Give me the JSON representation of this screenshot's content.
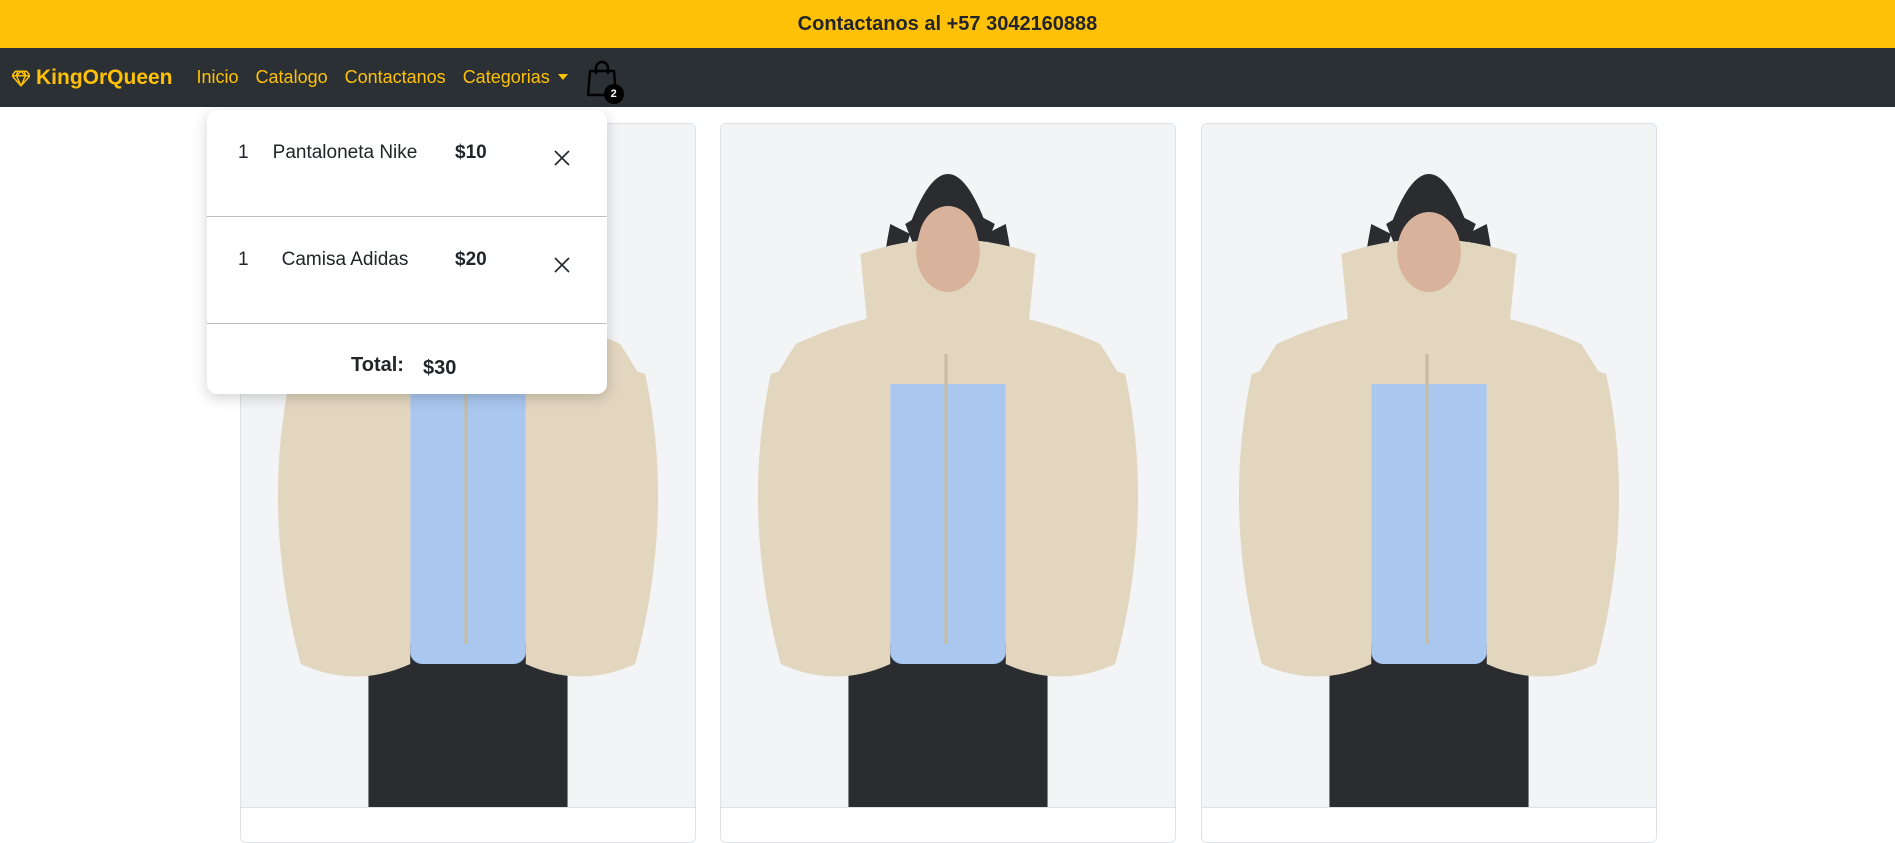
{
  "topbar": {
    "contact_text": "Contactanos al +57 3042160888"
  },
  "navbar": {
    "brand": "KingOrQueen",
    "links": [
      "Inicio",
      "Catalogo",
      "Contactanos",
      "Categorias"
    ],
    "cart_count": "2"
  },
  "cart": {
    "items": [
      {
        "qty": "1",
        "name": "Pantaloneta Nike",
        "price": "$10"
      },
      {
        "qty": "1",
        "name": "Camisa Adidas",
        "price": "$20"
      }
    ],
    "total_label": "Total:",
    "total_value": "$30"
  },
  "colors": {
    "accent": "#ffc107",
    "navbar_bg": "#2b3035",
    "jacket": "#e2d6bf",
    "shirt": "#a9c7ef",
    "pants": "#2a2c30"
  },
  "icons": {
    "brand": "gem-icon",
    "cart": "shopping-bag-icon",
    "remove": "close-icon"
  }
}
